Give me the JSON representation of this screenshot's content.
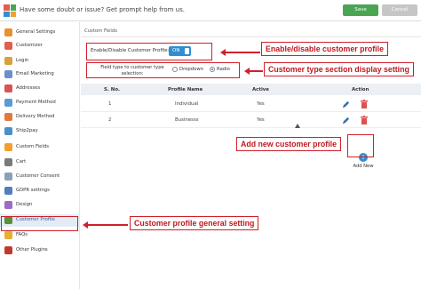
{
  "header": {
    "message": "Have some doubt or issue? Get prompt help from us.",
    "save_label": "Save",
    "cancel_label": "Cancel"
  },
  "sidebar": {
    "items": [
      {
        "label": "General Settings",
        "icon": "wrench-icon",
        "color": "#e8912e"
      },
      {
        "label": "Customizer",
        "icon": "palette-icon",
        "color": "#e25d4b"
      },
      {
        "label": "Login",
        "icon": "key-icon",
        "color": "#d8a23a"
      },
      {
        "label": "Email Marketing",
        "icon": "email-icon",
        "color": "#6a8fc9"
      },
      {
        "label": "Addresses",
        "icon": "location-icon",
        "color": "#d9534f"
      },
      {
        "label": "Payment Method",
        "icon": "card-icon",
        "color": "#5b9bd5"
      },
      {
        "label": "Delivery Method",
        "icon": "truck-icon",
        "color": "#e07a3f"
      },
      {
        "label": "Ship2pay",
        "icon": "ship-icon",
        "color": "#4a90c8"
      },
      {
        "label": "Custom Fields",
        "icon": "fields-icon",
        "color": "#f0a030"
      },
      {
        "label": "Cart",
        "icon": "cart-icon",
        "color": "#7a7a7a"
      },
      {
        "label": "Customer Consent",
        "icon": "consent-icon",
        "color": "#8aa0b8"
      },
      {
        "label": "GDPR settings",
        "icon": "gdpr-icon",
        "color": "#4e7fbf"
      },
      {
        "label": "Design",
        "icon": "design-icon",
        "color": "#9a6cc2"
      },
      {
        "label": "Customer Profile",
        "icon": "profile-icon",
        "color": "#5a8f3c"
      },
      {
        "label": "FAQs",
        "icon": "faq-icon",
        "color": "#e8b030"
      },
      {
        "label": "Other Plugins",
        "icon": "plugins-icon",
        "color": "#c0392b"
      }
    ],
    "active_index": 13
  },
  "main": {
    "breadcrumb": "Custom Fields",
    "enable_label": "Enable/Disable Customer Profile:",
    "toggle_value": "ON",
    "field_type_label": "Field type to customer type selection:",
    "radio_options": [
      "Dropdown",
      "Radio"
    ],
    "radio_selected": "Radio",
    "table": {
      "headers": [
        "S. No.",
        "Profile Name",
        "Active",
        "Action"
      ],
      "rows": [
        {
          "sno": "1",
          "name": "Individual",
          "active": "Yes"
        },
        {
          "sno": "2",
          "name": "Businesss",
          "active": "Yes"
        }
      ]
    },
    "add_new_label": "Add New"
  },
  "callouts": {
    "enable": "Enable/disable customer profile",
    "type": "Customer type section display setting",
    "add": "Add new customer profile",
    "general": "Customer profile general setting"
  },
  "colors": {
    "accent": "#2f8fd0",
    "highlight": "#d0202a",
    "save": "#4aa553"
  }
}
